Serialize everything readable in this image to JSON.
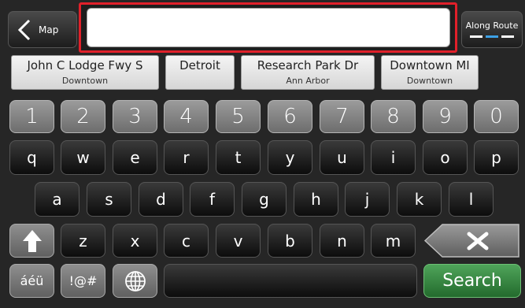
{
  "topbar": {
    "back_label": "Map",
    "search_value": "",
    "along_route_label": "Along Route"
  },
  "suggestions": [
    {
      "main": "John C Lodge Fwy S",
      "sub": "Downtown"
    },
    {
      "main": "Detroit",
      "sub": ""
    },
    {
      "main": "Research Park Dr",
      "sub": "Ann Arbor"
    },
    {
      "main": "Downtown MI",
      "sub": "Downtown"
    }
  ],
  "keyboard": {
    "numbers": [
      "1",
      "2",
      "3",
      "4",
      "5",
      "6",
      "7",
      "8",
      "9",
      "0"
    ],
    "row1": [
      "q",
      "w",
      "e",
      "r",
      "t",
      "y",
      "u",
      "i",
      "o",
      "p"
    ],
    "row2": [
      "a",
      "s",
      "d",
      "f",
      "g",
      "h",
      "j",
      "k",
      "l"
    ],
    "row3": [
      "z",
      "x",
      "c",
      "v",
      "b",
      "n",
      "m"
    ],
    "accent_label": "áéü",
    "symbols_label": "!@#",
    "search_label": "Search"
  },
  "icons": {
    "back": "chevron-left-icon",
    "shift": "shift-arrow-icon",
    "globe": "globe-icon",
    "backspace": "backspace-icon"
  },
  "colors": {
    "highlight_frame": "#e0202a",
    "search_button": "#3a8a44",
    "route_indicator": "#3da1e6"
  }
}
